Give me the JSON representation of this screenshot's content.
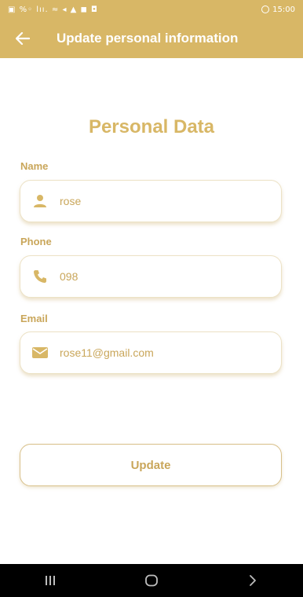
{
  "status_bar": {
    "left_icons": "▣ %◦ lıı. ≈ ◂ ▲ ◼ ◘",
    "time": "15:00"
  },
  "app_bar": {
    "title": "Update personal information"
  },
  "form": {
    "section_title": "Personal Data",
    "fields": [
      {
        "label": "Name",
        "value": "rose",
        "icon": "person-icon"
      },
      {
        "label": "Phone",
        "value": "098",
        "icon": "phone-icon"
      },
      {
        "label": "Email",
        "value": "rose11@gmail.com",
        "icon": "mail-icon"
      }
    ],
    "update_label": "Update"
  },
  "nav_bar": {
    "recent_icon": "recent-apps-icon",
    "home_icon": "home-icon",
    "back_icon": "nav-back-icon"
  },
  "colors": {
    "accent": "#d8b766",
    "label": "#c9a65a"
  }
}
